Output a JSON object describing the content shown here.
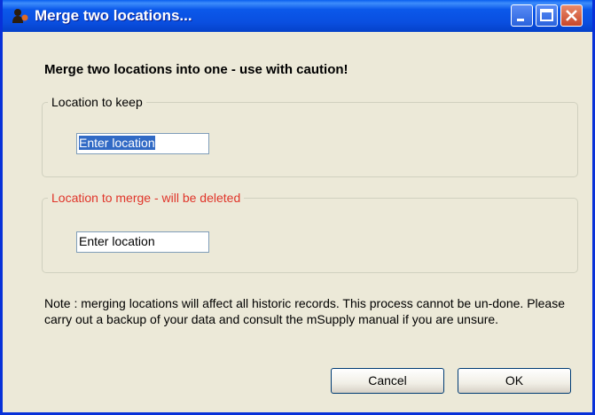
{
  "window": {
    "title": "Merge two locations...",
    "icon": "user-icon",
    "controls": [
      "minimize-icon",
      "maximize-icon",
      "close-icon"
    ]
  },
  "dialog": {
    "heading": "Merge two locations into one - use with caution!",
    "keep_group": {
      "label": "Location to keep",
      "input_value": "Enter location"
    },
    "merge_group": {
      "label": "Location to merge - will be deleted",
      "label_color": "#e0352a",
      "input_value": "Enter location"
    },
    "note": "Note : merging locations will affect all historic records. This process cannot be un-done.  Please carry out a backup of your data and  consult the mSupply manual if you are unsure.",
    "buttons": {
      "cancel_label": "Cancel",
      "ok_label": "OK"
    }
  },
  "colors": {
    "titlebar": "#0a4fe0",
    "window_bg": "#ece9d8",
    "selection": "#316ac5"
  }
}
